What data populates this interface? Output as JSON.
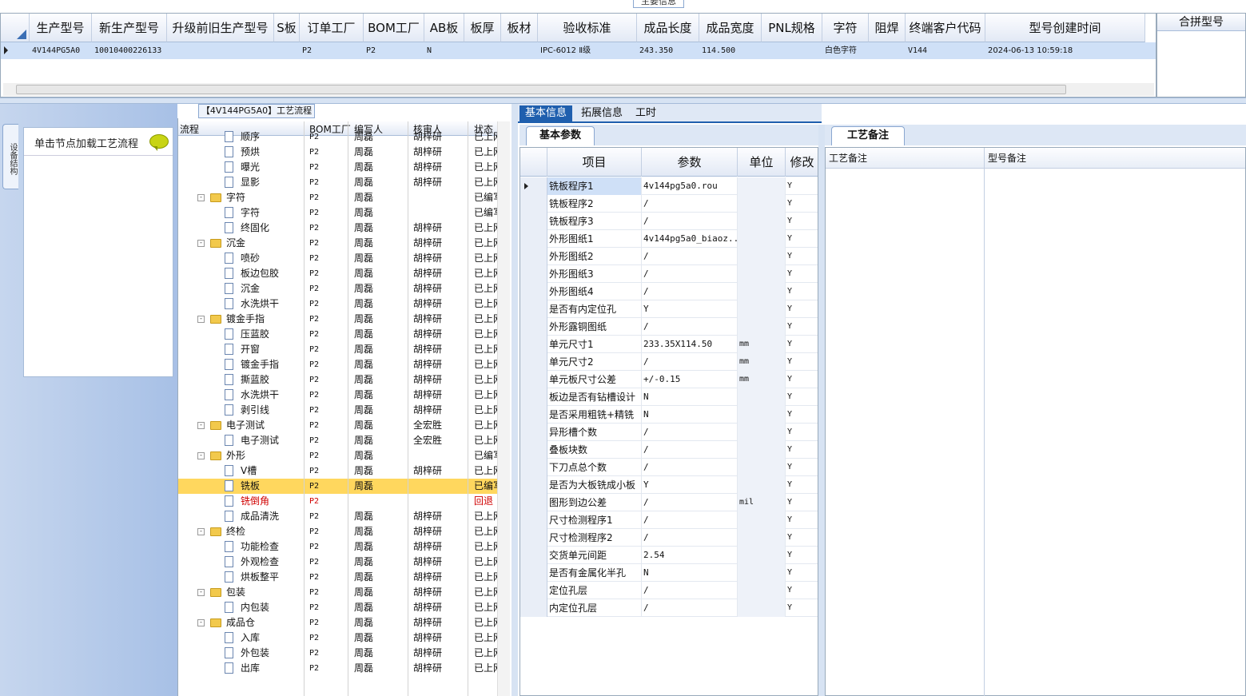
{
  "top_panel_title": "主要信息",
  "main_grid": {
    "columns": [
      "生产型号",
      "新生产型号",
      "升级前旧生产型号",
      "S板",
      "订单工厂",
      "BOM工厂",
      "AB板",
      "板厚",
      "板材",
      "验收标准",
      "成品长度",
      "成品宽度",
      "PNL规格",
      "字符",
      "阻焊",
      "终端客户代码",
      "型号创建时间"
    ],
    "row": [
      "4V144PG5A0",
      "10010400226133",
      "",
      "",
      "P2",
      "P2",
      "N",
      "",
      "",
      "IPC-6012 Ⅱ级",
      "243.350",
      "114.500",
      "",
      "白色字符",
      "",
      "V144",
      "2024-06-13 10:59:18"
    ]
  },
  "merge_panel": {
    "header": "合拼型号"
  },
  "left_panel": {
    "vertical_tab": "设备结构",
    "hint": "单击节点加载工艺流程"
  },
  "tree": {
    "title": "【4V144PG5A0】工艺流程",
    "columns": [
      "流程",
      "BOM工厂",
      "编写人",
      "核审人",
      "状态"
    ],
    "rows": [
      {
        "level": 2,
        "name": "顺序",
        "bom": "P2",
        "author": "周磊",
        "reviewer": "胡梓研",
        "status": "已上网"
      },
      {
        "level": 2,
        "name": "预烘",
        "bom": "P2",
        "author": "周磊",
        "reviewer": "胡梓研",
        "status": "已上网"
      },
      {
        "level": 2,
        "name": "曝光",
        "bom": "P2",
        "author": "周磊",
        "reviewer": "胡梓研",
        "status": "已上网"
      },
      {
        "level": 2,
        "name": "显影",
        "bom": "P2",
        "author": "周磊",
        "reviewer": "胡梓研",
        "status": "已上网"
      },
      {
        "level": 1,
        "name": "字符",
        "bom": "P2",
        "author": "周磊",
        "reviewer": "",
        "status": "已编写"
      },
      {
        "level": 2,
        "name": "字符",
        "bom": "P2",
        "author": "周磊",
        "reviewer": "",
        "status": "已编写"
      },
      {
        "level": 2,
        "name": "终固化",
        "bom": "P2",
        "author": "周磊",
        "reviewer": "胡梓研",
        "status": "已上网"
      },
      {
        "level": 1,
        "name": "沉金",
        "bom": "P2",
        "author": "周磊",
        "reviewer": "胡梓研",
        "status": "已上网"
      },
      {
        "level": 2,
        "name": "喷砂",
        "bom": "P2",
        "author": "周磊",
        "reviewer": "胡梓研",
        "status": "已上网"
      },
      {
        "level": 2,
        "name": "板边包胶",
        "bom": "P2",
        "author": "周磊",
        "reviewer": "胡梓研",
        "status": "已上网"
      },
      {
        "level": 2,
        "name": "沉金",
        "bom": "P2",
        "author": "周磊",
        "reviewer": "胡梓研",
        "status": "已上网"
      },
      {
        "level": 2,
        "name": "水洗烘干",
        "bom": "P2",
        "author": "周磊",
        "reviewer": "胡梓研",
        "status": "已上网"
      },
      {
        "level": 1,
        "name": "镀金手指",
        "bom": "P2",
        "author": "周磊",
        "reviewer": "胡梓研",
        "status": "已上网"
      },
      {
        "level": 2,
        "name": "压蓝胶",
        "bom": "P2",
        "author": "周磊",
        "reviewer": "胡梓研",
        "status": "已上网"
      },
      {
        "level": 2,
        "name": "开窗",
        "bom": "P2",
        "author": "周磊",
        "reviewer": "胡梓研",
        "status": "已上网"
      },
      {
        "level": 2,
        "name": "镀金手指",
        "bom": "P2",
        "author": "周磊",
        "reviewer": "胡梓研",
        "status": "已上网"
      },
      {
        "level": 2,
        "name": "撕蓝胶",
        "bom": "P2",
        "author": "周磊",
        "reviewer": "胡梓研",
        "status": "已上网"
      },
      {
        "level": 2,
        "name": "水洗烘干",
        "bom": "P2",
        "author": "周磊",
        "reviewer": "胡梓研",
        "status": "已上网"
      },
      {
        "level": 2,
        "name": "剥引线",
        "bom": "P2",
        "author": "周磊",
        "reviewer": "胡梓研",
        "status": "已上网"
      },
      {
        "level": 1,
        "name": "电子测试",
        "bom": "P2",
        "author": "周磊",
        "reviewer": "全宏胜",
        "status": "已上网"
      },
      {
        "level": 2,
        "name": "电子测试",
        "bom": "P2",
        "author": "周磊",
        "reviewer": "全宏胜",
        "status": "已上网"
      },
      {
        "level": 1,
        "name": "外形",
        "bom": "P2",
        "author": "周磊",
        "reviewer": "",
        "status": "已编写"
      },
      {
        "level": 2,
        "name": "V槽",
        "bom": "P2",
        "author": "周磊",
        "reviewer": "胡梓研",
        "status": "已上网"
      },
      {
        "level": 2,
        "name": "铣板",
        "bom": "P2",
        "author": "周磊",
        "reviewer": "",
        "status": "已编写",
        "selected": true
      },
      {
        "level": 2,
        "name": "铣倒角",
        "bom": "P2",
        "author": "",
        "reviewer": "",
        "status": "回退",
        "red": true
      },
      {
        "level": 2,
        "name": "成品清洗",
        "bom": "P2",
        "author": "周磊",
        "reviewer": "胡梓研",
        "status": "已上网"
      },
      {
        "level": 1,
        "name": "终检",
        "bom": "P2",
        "author": "周磊",
        "reviewer": "胡梓研",
        "status": "已上网"
      },
      {
        "level": 2,
        "name": "功能检查",
        "bom": "P2",
        "author": "周磊",
        "reviewer": "胡梓研",
        "status": "已上网"
      },
      {
        "level": 2,
        "name": "外观检查",
        "bom": "P2",
        "author": "周磊",
        "reviewer": "胡梓研",
        "status": "已上网"
      },
      {
        "level": 2,
        "name": "烘板整平",
        "bom": "P2",
        "author": "周磊",
        "reviewer": "胡梓研",
        "status": "已上网"
      },
      {
        "level": 1,
        "name": "包装",
        "bom": "P2",
        "author": "周磊",
        "reviewer": "胡梓研",
        "status": "已上网"
      },
      {
        "level": 2,
        "name": "内包装",
        "bom": "P2",
        "author": "周磊",
        "reviewer": "胡梓研",
        "status": "已上网"
      },
      {
        "level": 1,
        "name": "成品仓",
        "bom": "P2",
        "author": "周磊",
        "reviewer": "胡梓研",
        "status": "已上网"
      },
      {
        "level": 2,
        "name": "入库",
        "bom": "P2",
        "author": "周磊",
        "reviewer": "胡梓研",
        "status": "已上网"
      },
      {
        "level": 2,
        "name": "外包装",
        "bom": "P2",
        "author": "周磊",
        "reviewer": "胡梓研",
        "status": "已上网"
      },
      {
        "level": 2,
        "name": "出库",
        "bom": "P2",
        "author": "周磊",
        "reviewer": "胡梓研",
        "status": "已上网"
      }
    ]
  },
  "tabs": [
    "基本信息",
    "拓展信息",
    "工时"
  ],
  "params": {
    "section_tab": "基本参数",
    "columns": [
      "项目",
      "参数",
      "单位",
      "修改"
    ],
    "rows": [
      {
        "item": "铣板程序1",
        "value": "4v144pg5a0.rou",
        "unit": "",
        "mod": "Y"
      },
      {
        "item": "铣板程序2",
        "value": "/",
        "unit": "",
        "mod": "Y"
      },
      {
        "item": "铣板程序3",
        "value": "/",
        "unit": "",
        "mod": "Y"
      },
      {
        "item": "外形图纸1",
        "value": "4v144pg5a0_biaoz...",
        "unit": "",
        "mod": "Y"
      },
      {
        "item": "外形图纸2",
        "value": "/",
        "unit": "",
        "mod": "Y"
      },
      {
        "item": "外形图纸3",
        "value": "/",
        "unit": "",
        "mod": "Y"
      },
      {
        "item": "外形图纸4",
        "value": "/",
        "unit": "",
        "mod": "Y"
      },
      {
        "item": "是否有内定位孔",
        "value": "Y",
        "unit": "",
        "mod": "Y"
      },
      {
        "item": "外形露铜图纸",
        "value": "/",
        "unit": "",
        "mod": "Y"
      },
      {
        "item": "单元尺寸1",
        "value": "233.35X114.50",
        "unit": "mm",
        "mod": "Y"
      },
      {
        "item": "单元尺寸2",
        "value": "/",
        "unit": "mm",
        "mod": "Y"
      },
      {
        "item": "单元板尺寸公差",
        "value": "+/-0.15",
        "unit": "mm",
        "mod": "Y"
      },
      {
        "item": "板边是否有钻槽设计",
        "value": "N",
        "unit": "",
        "mod": "Y"
      },
      {
        "item": "是否采用粗铣+精铣",
        "value": "N",
        "unit": "",
        "mod": "Y"
      },
      {
        "item": "异形槽个数",
        "value": "/",
        "unit": "",
        "mod": "Y"
      },
      {
        "item": "叠板块数",
        "value": "/",
        "unit": "",
        "mod": "Y"
      },
      {
        "item": "下刀点总个数",
        "value": "/",
        "unit": "",
        "mod": "Y"
      },
      {
        "item": "是否为大板铣成小板",
        "value": "Y",
        "unit": "",
        "mod": "Y"
      },
      {
        "item": "图形到边公差",
        "value": "/",
        "unit": "mil",
        "mod": "Y"
      },
      {
        "item": "尺寸检测程序1",
        "value": "/",
        "unit": "",
        "mod": "Y"
      },
      {
        "item": "尺寸检测程序2",
        "value": "/",
        "unit": "",
        "mod": "Y"
      },
      {
        "item": "交货单元间距",
        "value": "2.54",
        "unit": "",
        "mod": "Y"
      },
      {
        "item": "是否有金属化半孔",
        "value": "N",
        "unit": "",
        "mod": "Y"
      },
      {
        "item": "定位孔层",
        "value": "/",
        "unit": "",
        "mod": "Y"
      },
      {
        "item": "内定位孔层",
        "value": "/",
        "unit": "",
        "mod": "Y"
      }
    ]
  },
  "notes": {
    "tab": "工艺备注",
    "col1": "工艺备注",
    "col2": "型号备注"
  },
  "colors": {
    "accent": "#1f5fae",
    "selected_row": "#cfe0f7",
    "tree_highlight": "#ffd75e",
    "rollback": "#d00000"
  }
}
